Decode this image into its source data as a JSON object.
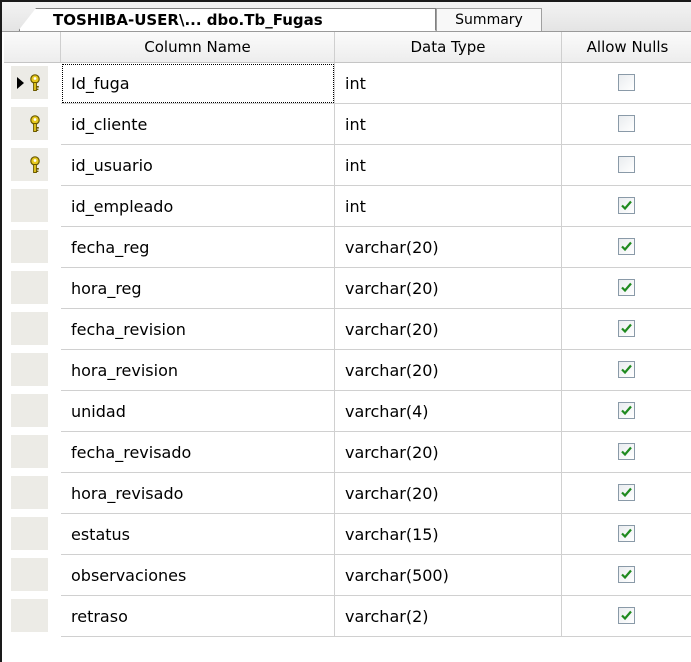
{
  "tabs": {
    "active_label": "TOSHIBA-USER\\... dbo.Tb_Fugas",
    "inactive_label": "Summary"
  },
  "headers": {
    "column_name": "Column Name",
    "data_type": "Data Type",
    "allow_nulls": "Allow Nulls"
  },
  "rows": [
    {
      "name": "Id_fuga",
      "type": "int",
      "allow_nulls": false,
      "primary_key": true,
      "current": true
    },
    {
      "name": "id_cliente",
      "type": "int",
      "allow_nulls": false,
      "primary_key": true
    },
    {
      "name": "id_usuario",
      "type": "int",
      "allow_nulls": false,
      "primary_key": true
    },
    {
      "name": "id_empleado",
      "type": "int",
      "allow_nulls": true
    },
    {
      "name": "fecha_reg",
      "type": "varchar(20)",
      "allow_nulls": true
    },
    {
      "name": "hora_reg",
      "type": "varchar(20)",
      "allow_nulls": true
    },
    {
      "name": "fecha_revision",
      "type": "varchar(20)",
      "allow_nulls": true
    },
    {
      "name": "hora_revision",
      "type": "varchar(20)",
      "allow_nulls": true
    },
    {
      "name": "unidad",
      "type": "varchar(4)",
      "allow_nulls": true
    },
    {
      "name": "fecha_revisado",
      "type": "varchar(20)",
      "allow_nulls": true
    },
    {
      "name": "hora_revisado",
      "type": "varchar(20)",
      "allow_nulls": true
    },
    {
      "name": "estatus",
      "type": "varchar(15)",
      "allow_nulls": true
    },
    {
      "name": "observaciones",
      "type": "varchar(500)",
      "allow_nulls": true
    },
    {
      "name": "retraso",
      "type": "varchar(2)",
      "allow_nulls": true
    }
  ],
  "icons": {
    "primary_key": "key-icon",
    "current_row": "row-pointer-arrow-icon",
    "checked": "check-icon"
  },
  "colors": {
    "key": "#e6c81e",
    "check": "#1f8a1f"
  }
}
